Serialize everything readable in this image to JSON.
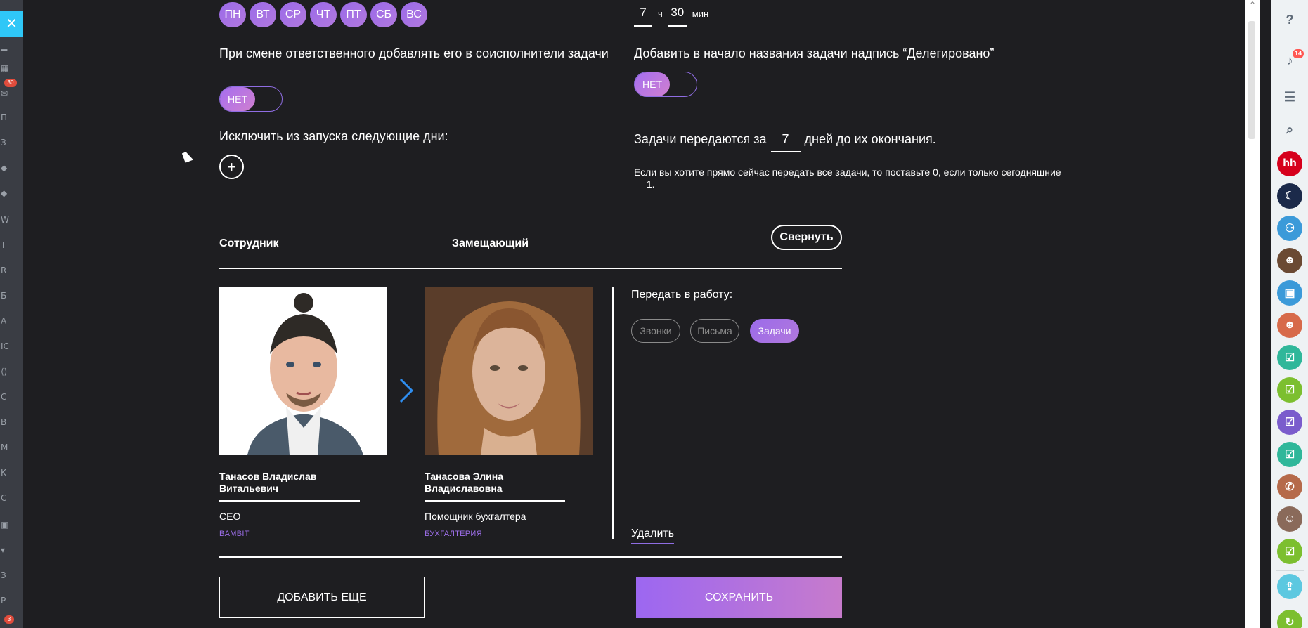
{
  "close_icon": "✕",
  "left_strip": {
    "labels": [
      "П",
      "З",
      "W",
      "T",
      "R",
      "Б",
      "А",
      "IC",
      "C",
      "B",
      "M",
      "K",
      "C",
      "З",
      "P"
    ],
    "badge_top": "30",
    "badge_bottom": "3"
  },
  "schedule": {
    "days": [
      "ПН",
      "ВТ",
      "СР",
      "ЧТ",
      "ПТ",
      "СБ",
      "ВС"
    ],
    "hours": "7",
    "hours_unit": "ч",
    "minutes": "30",
    "minutes_unit": "мин"
  },
  "options": {
    "add_coexecutor_label": "При смене ответственного добавлять его в соисполнители задачи",
    "add_coexecutor_toggle": "НЕТ",
    "delegated_prefix_label": "Добавить в начало названия задачи надпись “Делегировано”",
    "delegated_prefix_toggle": "НЕТ",
    "exclude_days_label": "Исключить из запуска следующие дни:",
    "add_icon": "+",
    "days_before_prefix": "Задачи передаются за",
    "days_before_value": "7",
    "days_before_suffix": "дней до их окончания.",
    "hint": "Если вы хотите прямо сейчас передать все задачи, то поставьте 0, если только сегодняшние — 1."
  },
  "table": {
    "col_employee": "Сотрудник",
    "col_substitute": "Замещающий",
    "collapse_button": "Свернуть"
  },
  "employee": {
    "name": "Танасов Владислав Витальевич",
    "position": "CEO",
    "department": "BAMBIT"
  },
  "substitute": {
    "name": "Танасова Элина Владиславовна",
    "position": "Помощник бухгалтера",
    "department": "БУХГАЛТЕРИЯ"
  },
  "transfer": {
    "label": "Передать в работу:",
    "chips": [
      {
        "label": "Звонки",
        "active": false
      },
      {
        "label": "Письма",
        "active": false
      },
      {
        "label": "Задачи",
        "active": true
      }
    ],
    "delete_link": "Удалить"
  },
  "actions": {
    "add_more": "ДОБАВИТЬ ЕЩЕ",
    "save": "СОХРАНИТЬ"
  },
  "right_panel": {
    "notification_count": "14",
    "hh_label": "hh",
    "icons": [
      "help-icon",
      "bell-icon",
      "chat-icon",
      "search-icon",
      "hh-avatar",
      "night-avatar",
      "group-icon",
      "woman-avatar",
      "lock-icon",
      "red-avatar",
      "task-icon",
      "task-icon",
      "task-icon",
      "task-icon",
      "phone-icon",
      "man-avatar",
      "task-icon",
      "cloud-icon",
      "refresh-icon"
    ]
  },
  "colors": {
    "accent": "#9b6bea",
    "background": "#1e1e21",
    "link_blue": "#2f8ef0"
  }
}
